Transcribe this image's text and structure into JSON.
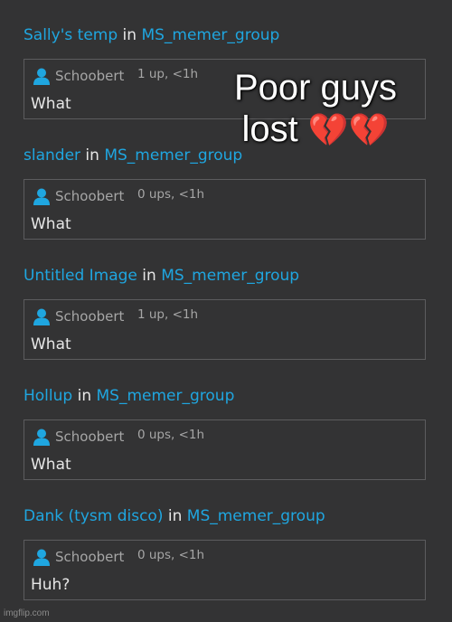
{
  "colors": {
    "background": "#333334",
    "link": "#1fa6e0",
    "text": "#e6e6e6",
    "muted": "#a6a6a6",
    "border": "#5c5c5e"
  },
  "icons": {
    "user": "user-icon"
  },
  "caption": {
    "line1": "Poor guys",
    "line2": "lost",
    "emoji": "💔💔"
  },
  "watermark": "imgflip.com",
  "entries": [
    {
      "title": "Sally's temp",
      "connector": "in",
      "group": "MS_memer_group",
      "username": "Schoobert",
      "meta": "1 up, <1h",
      "text": "What"
    },
    {
      "title": "slander",
      "connector": "in",
      "group": "MS_memer_group",
      "username": "Schoobert",
      "meta": "0 ups, <1h",
      "text": "What"
    },
    {
      "title": "Untitled Image",
      "connector": "in",
      "group": "MS_memer_group",
      "username": "Schoobert",
      "meta": "1 up, <1h",
      "text": "What"
    },
    {
      "title": "Hollup",
      "connector": "in",
      "group": "MS_memer_group",
      "username": "Schoobert",
      "meta": "0 ups, <1h",
      "text": "What"
    },
    {
      "title": "Dank (tysm disco)",
      "connector": "in",
      "group": "MS_memer_group",
      "username": "Schoobert",
      "meta": "0 ups, <1h",
      "text": "Huh?"
    }
  ]
}
